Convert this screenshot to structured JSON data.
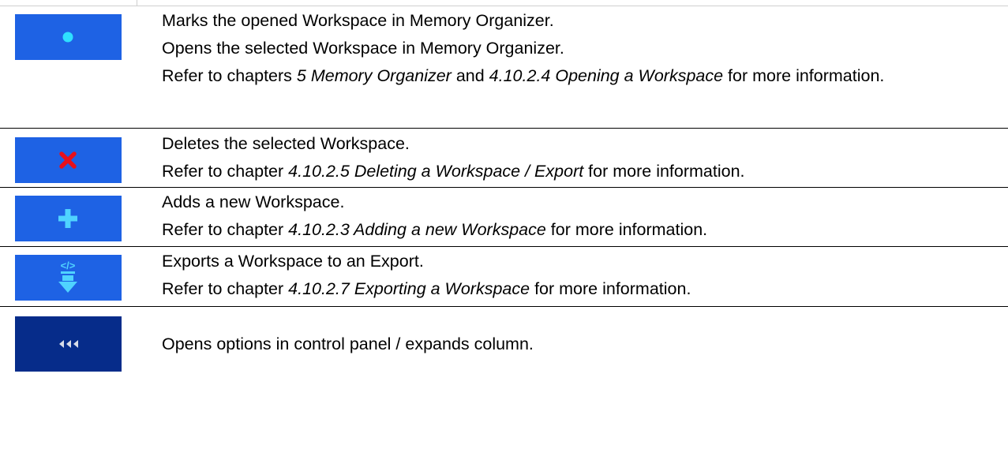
{
  "rows": [
    {
      "icon": "dot-icon",
      "lines": [
        "Marks the opened Workspace in Memory Organizer.",
        "Opens the selected Workspace in Memory Organizer."
      ],
      "ref": {
        "pre": "Refer to chapters ",
        "i1": "5 Memory Organizer",
        "mid": " and ",
        "i2": "4.10.2.4 Opening a Workspace",
        "post": " for more information."
      }
    },
    {
      "icon": "delete-cross-icon",
      "lines": [
        "Deletes the selected Workspace."
      ],
      "ref": {
        "pre": "Refer to chapter ",
        "i1": "4.10.2.5 Deleting a Workspace / Export",
        "post": " for more information."
      }
    },
    {
      "icon": "add-plus-icon",
      "lines": [
        "Adds a new Workspace."
      ],
      "ref": {
        "pre": "Refer to chapter ",
        "i1": "4.10.2.3 Adding a new Workspace",
        "post": " for more information."
      }
    },
    {
      "icon": "export-arrow-icon",
      "icon_glyph": "</>",
      "lines": [
        "Exports a Workspace to an Export."
      ],
      "ref": {
        "pre": "Refer to chapter ",
        "i1": "4.10.2.7 Exporting a Workspace",
        "post": " for more information."
      }
    },
    {
      "icon": "expand-options-icon",
      "lines": [
        "Opens options in control panel / expands column."
      ]
    }
  ],
  "colors": {
    "icon_blue": "#1e62e4",
    "icon_dark_blue": "#062c8a",
    "dot": "#2ee0ff",
    "cross": "#e8101c",
    "plus": "#4fd3ff",
    "arrow": "#4fd3ff",
    "arrows_gray": "#d8dde8"
  }
}
